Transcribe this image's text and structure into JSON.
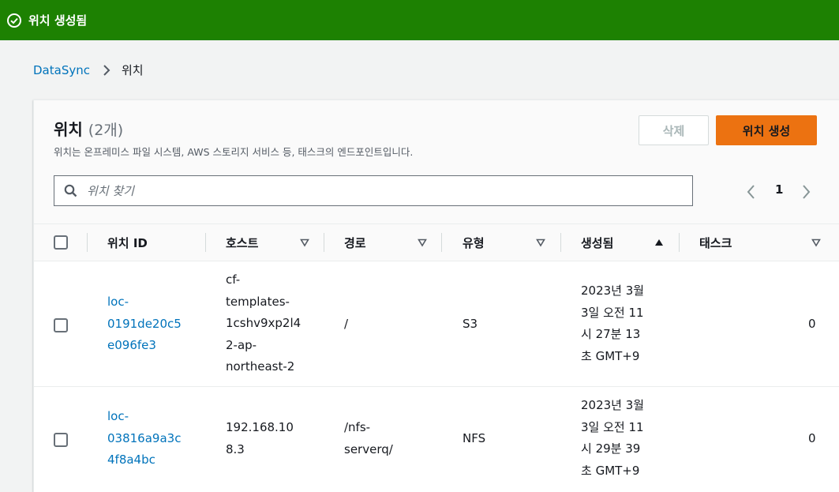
{
  "banner": {
    "message": "위치 생성됨",
    "color": "#1d8102"
  },
  "breadcrumb": {
    "root": "DataSync",
    "current": "위치"
  },
  "panel": {
    "title": "위치",
    "count": "(2개)",
    "description": "위치는 온프레미스 파일 시스템, AWS 스토리지 서비스 등, 태스크의 엔드포인트입니다.",
    "delete_label": "삭제",
    "create_label": "위치 생성"
  },
  "search": {
    "placeholder": "위치 찾기",
    "value": ""
  },
  "pagination": {
    "current_page": "1"
  },
  "table": {
    "columns": [
      "위치 ID",
      "호스트",
      "경로",
      "유형",
      "생성됨",
      "태스크"
    ],
    "rows": [
      {
        "id_lines": [
          "loc-",
          "0191de20c5",
          "e096fe3"
        ],
        "host_lines": [
          "cf-",
          "templates-",
          "1cshv9xp2l4",
          "2-ap-",
          "northeast-2"
        ],
        "path": "/",
        "type": "S3",
        "created_lines": [
          "2023년 3월",
          "3일 오전 11",
          "시 27분 13",
          "초 GMT+9"
        ],
        "tasks": "0"
      },
      {
        "id_lines": [
          "loc-",
          "03816a9a3c",
          "4f8a4bc"
        ],
        "host_lines": [
          "192.168.10",
          "8.3"
        ],
        "path_lines": [
          "/nfs-",
          "serverq/"
        ],
        "type": "NFS",
        "created_lines": [
          "2023년 3월",
          "3일 오전 11",
          "시 29분 39",
          "초 GMT+9"
        ],
        "tasks": "0"
      }
    ]
  },
  "icons": {
    "success": "check-circle-icon",
    "breadcrumb_separator": "chevron-right-icon",
    "search": "search-icon",
    "prev": "chevron-left-icon",
    "next": "chevron-right-icon",
    "sort_down": "caret-down-icon",
    "sort_up": "caret-up-icon"
  },
  "colors": {
    "link": "#0073bb",
    "primary_button": "#ec7211"
  }
}
